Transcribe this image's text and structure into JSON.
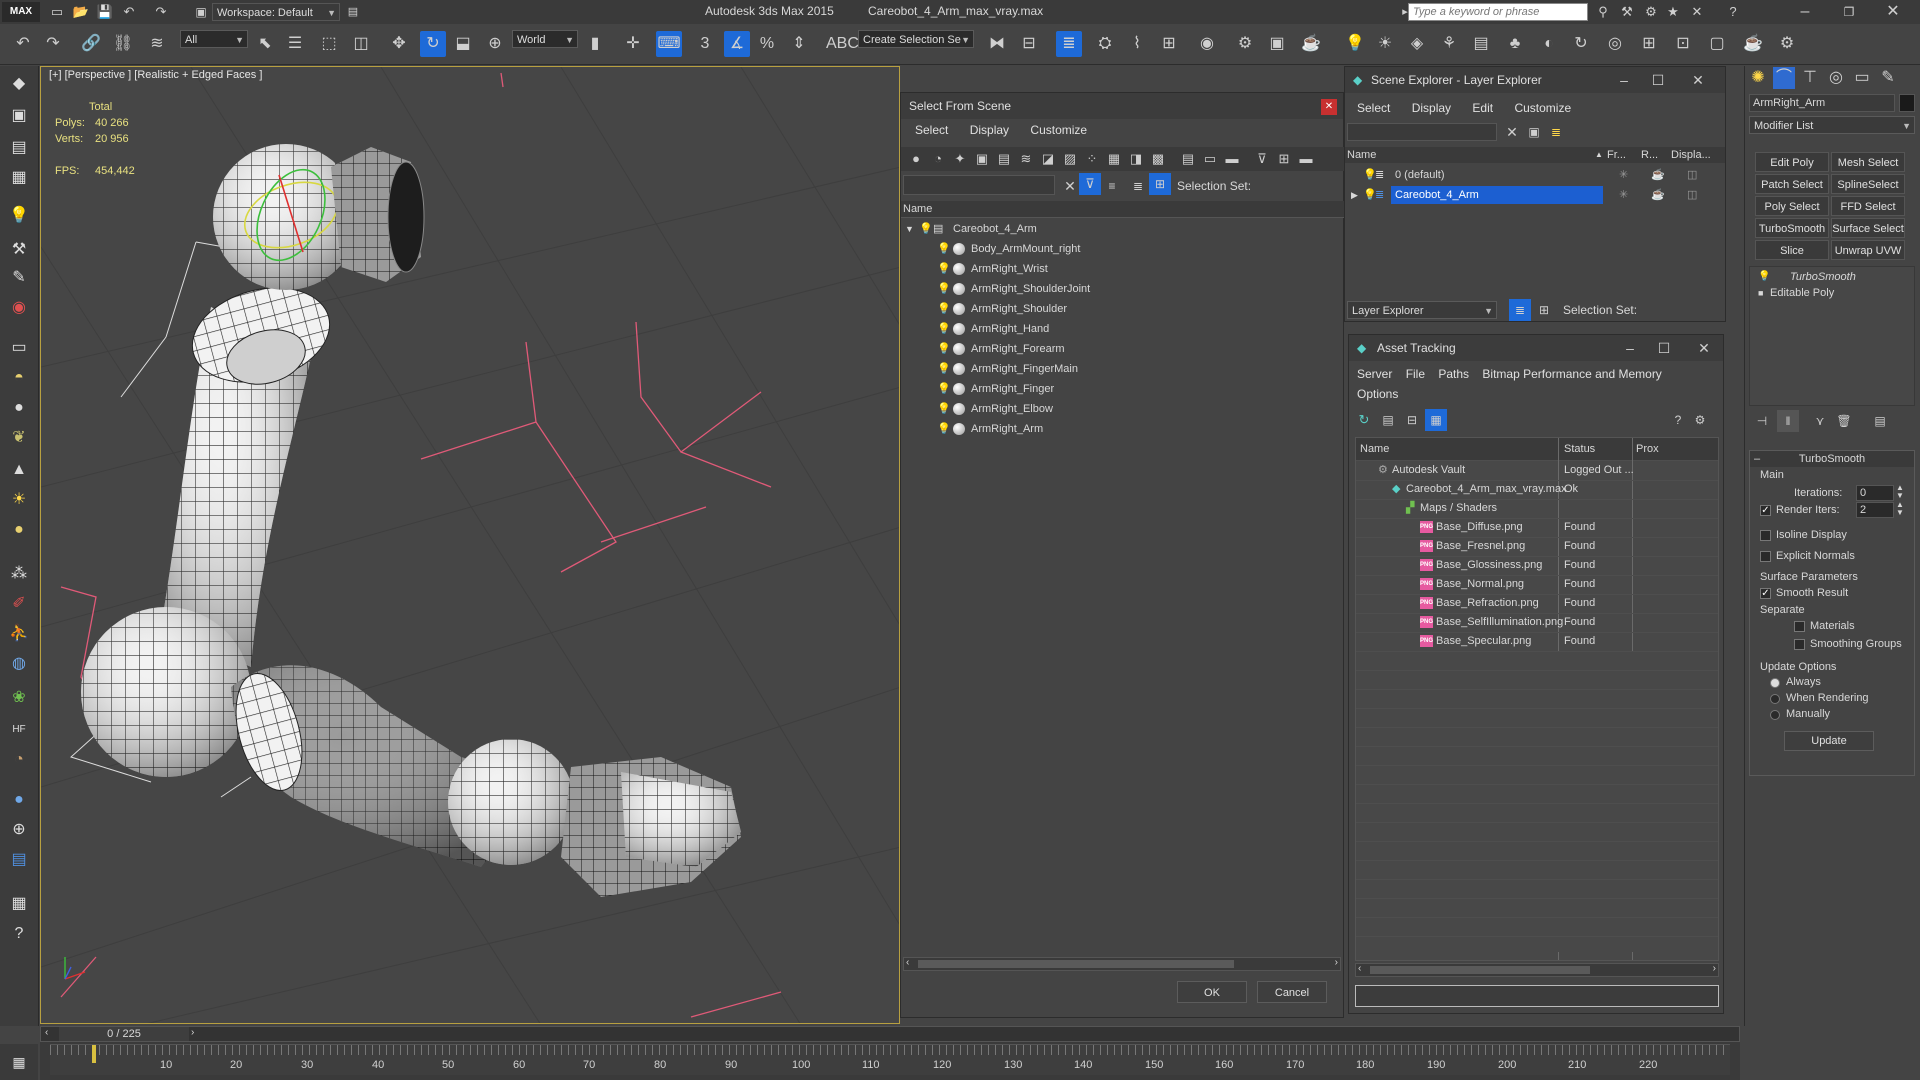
{
  "app": {
    "title": "Autodesk 3ds Max  2015",
    "filename": "Careobot_4_Arm_max_vray.max",
    "logo": "MAX",
    "search_placeholder": "Type a keyword or phrase"
  },
  "toolbar": {
    "workspace": "Workspace: Default",
    "selection_filter": "All",
    "coord_system": "World",
    "named_selection": "Create Selection Se"
  },
  "viewport": {
    "label": "[+] [Perspective ] [Realistic + Edged Faces ]",
    "stats": {
      "total_label": "Total",
      "polys_label": "Polys:",
      "polys_value": "40 266",
      "verts_label": "Verts:",
      "verts_value": "20 956",
      "fps_label": "FPS:",
      "fps_value": "454,442"
    }
  },
  "select_from_scene": {
    "title": "Select From Scene",
    "menus": [
      "Select",
      "Display",
      "Customize"
    ],
    "selection_set_label": "Selection Set:",
    "column_name": "Name",
    "root": "Careobot_4_Arm",
    "items": [
      "Body_ArmMount_right",
      "ArmRight_Wrist",
      "ArmRight_ShoulderJoint",
      "ArmRight_Shoulder",
      "ArmRight_Hand",
      "ArmRight_Forearm",
      "ArmRight_FingerMain",
      "ArmRight_Finger",
      "ArmRight_Elbow",
      "ArmRight_Arm"
    ],
    "ok_label": "OK",
    "cancel_label": "Cancel"
  },
  "scene_explorer": {
    "title": "Scene Explorer - Layer Explorer",
    "menus": [
      "Select",
      "Display",
      "Edit",
      "Customize"
    ],
    "columns": [
      "Name",
      "Fr...",
      "R...",
      "Displa..."
    ],
    "layers": [
      "0 (default)",
      "Careobot_4_Arm"
    ],
    "explorer_dropdown": "Layer Explorer",
    "selection_set_label": "Selection Set:"
  },
  "asset_tracking": {
    "title": "Asset Tracking",
    "menus": [
      "Server",
      "File",
      "Paths",
      "Bitmap Performance and Memory"
    ],
    "menu2": "Options",
    "columns": [
      "Name",
      "Status",
      "Prox"
    ],
    "rows": [
      {
        "name": "Autodesk Vault",
        "status": "Logged Out ..."
      },
      {
        "name": "Careobot_4_Arm_max_vray.max",
        "status": "Ok"
      },
      {
        "name": "Maps / Shaders",
        "status": ""
      },
      {
        "name": "Base_Diffuse.png",
        "status": "Found"
      },
      {
        "name": "Base_Fresnel.png",
        "status": "Found"
      },
      {
        "name": "Base_Glossiness.png",
        "status": "Found"
      },
      {
        "name": "Base_Normal.png",
        "status": "Found"
      },
      {
        "name": "Base_Refraction.png",
        "status": "Found"
      },
      {
        "name": "Base_SelfIllumination.png",
        "status": "Found"
      },
      {
        "name": "Base_Specular.png",
        "status": "Found"
      }
    ],
    "png_badge": "PNG"
  },
  "command_panel": {
    "object_name": "ArmRight_Arm",
    "modifier_list": "Modifier List",
    "buttons": [
      "Edit Poly",
      "Mesh Select",
      "Patch Select",
      "SplineSelect",
      "Poly Select",
      "FFD Select",
      "TurboSmooth",
      "Surface Select",
      "Slice",
      "Unwrap UVW"
    ],
    "stack": [
      "TurboSmooth",
      "Editable Poly"
    ],
    "rollout_title": "TurboSmooth",
    "main_label": "Main",
    "iterations_label": "Iterations:",
    "iterations_value": "0",
    "render_iters_label": "Render Iters:",
    "render_iters_value": "2",
    "isoline_label": "Isoline Display",
    "explicit_normals_label": "Explicit Normals",
    "surface_params_label": "Surface Parameters",
    "smooth_result_label": "Smooth Result",
    "separate_label": "Separate",
    "materials_label": "Materials",
    "smoothing_groups_label": "Smoothing Groups",
    "update_options_label": "Update Options",
    "always_label": "Always",
    "when_rendering_label": "When Rendering",
    "manually_label": "Manually",
    "update_button": "Update"
  },
  "timeline": {
    "frame_counter": "0 / 225",
    "ticks": [
      "10",
      "20",
      "30",
      "40",
      "50",
      "60",
      "70",
      "80",
      "90",
      "100",
      "110",
      "120",
      "130",
      "140",
      "150",
      "160",
      "170",
      "180",
      "190",
      "200",
      "210",
      "220"
    ]
  },
  "colors": {
    "selection_highlight": "#1c5fd1",
    "viewport_border": "#b8a040",
    "stats_text": "#e8e080"
  }
}
